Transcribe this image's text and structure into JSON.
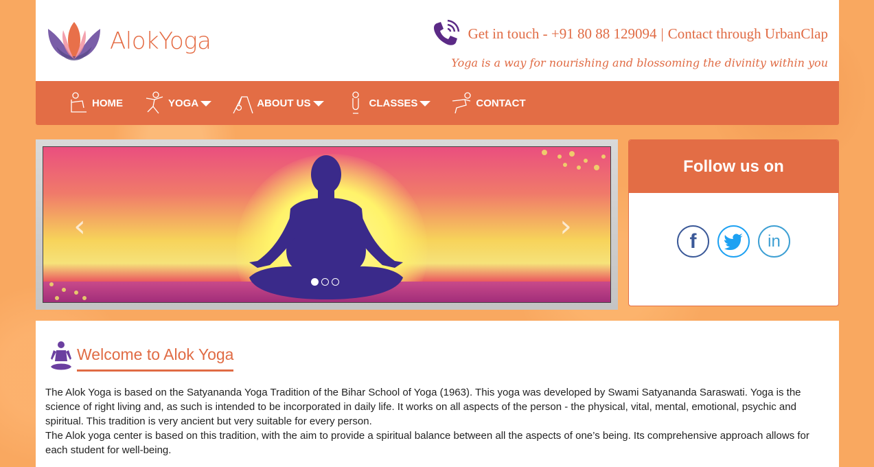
{
  "brand": {
    "name": "AlokYoga"
  },
  "contact": {
    "prefix": "Get in touch - +91 80 88 129094",
    "separator": "|",
    "link": "Contact through UrbanClap"
  },
  "tagline": "Yoga is a way for nourishing and blossoming the divinity within you",
  "nav": {
    "home": "HOME",
    "yoga": "YOGA",
    "about": "ABOUT US",
    "classes": "CLASSES",
    "contact": "CONTACT"
  },
  "slider": {
    "prev": "‹",
    "next": "›",
    "slide_count": 3,
    "active_index": 0
  },
  "follow": {
    "title": "Follow us on",
    "facebook": "f",
    "linkedin": "in"
  },
  "welcome": {
    "title": "Welcome to Alok Yoga",
    "para1": "The Alok Yoga is based on the Satyananda Yoga Tradition of the Bihar School of Yoga (1963). This yoga was developed by Swami Satyananda Saraswati. Yoga is the science of right living and, as such is intended to be incorporated in daily life. It works on all aspects of the person - the physical, vital, mental, emotional, psychic and spiritual. This tradition is very ancient but very suitable for every person.",
    "para2": "The Alok yoga center is based on this tradition, with the aim to provide a spiritual balance between all the aspects of one’s being. Its comprehensive approach allows for each student for well-being."
  },
  "colors": {
    "accent": "#e36d45",
    "background": "#f9a860",
    "purple": "#6b3fa0"
  }
}
